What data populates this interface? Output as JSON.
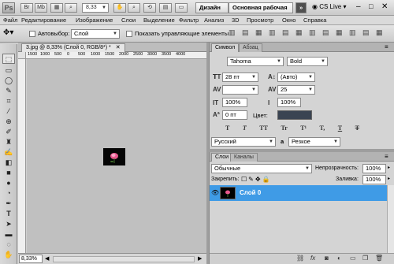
{
  "titlebar": {
    "logo": "Ps",
    "mb": "Mb",
    "zoom": "8,33",
    "workspace_design": "Дизайн",
    "workspace_main": "Основная рабочая среда",
    "overflow": "»",
    "cslive": "CS Live"
  },
  "menu": [
    "Файл",
    "Редактирование",
    "Изображение",
    "Слои",
    "Выделение",
    "Фильтр",
    "Анализ",
    "3D",
    "Просмотр",
    "Окно",
    "Справка"
  ],
  "options": {
    "autoselect_label": "Автовыбор:",
    "autoselect_value": "Слой",
    "show_controls_label": "Показать управляющие элементы"
  },
  "document": {
    "tab_title": "3.jpg @ 8,33% (Слой 0, RGB/8*) *",
    "ruler_ticks": [
      "1500",
      "1000",
      "500",
      "0",
      "500",
      "1000",
      "1500",
      "2000",
      "2500",
      "3000",
      "3500",
      "4000"
    ],
    "zoom": "8,33%"
  },
  "character_panel": {
    "tab_active": "Символ",
    "tab_inactive": "Абзац",
    "font_family": "Tahoma",
    "font_style": "Bold",
    "font_size": "28 пт",
    "leading": "(Авто)",
    "kerning": "",
    "tracking": "25",
    "vscale": "100%",
    "hscale": "100%",
    "baseline": "0 пт",
    "color_label": "Цвет:",
    "style_buttons": [
      "T",
      "T",
      "TT",
      "Tr",
      "T¹",
      "T,",
      "T",
      "T"
    ],
    "language": "Русский",
    "antialias_prefix": "a",
    "antialias": "Резкое"
  },
  "layers_panel": {
    "tab_active": "Слои",
    "tab_inactive": "Каналы",
    "blend_mode": "Обычные",
    "opacity_label": "Непрозрачность:",
    "opacity": "100%",
    "lock_label": "Закрепить:",
    "fill_label": "Заливка:",
    "fill": "100%",
    "layer_name": "Слой 0"
  },
  "colors": {
    "accent": "#3f9be6",
    "color_swatch": "#3a4452"
  }
}
